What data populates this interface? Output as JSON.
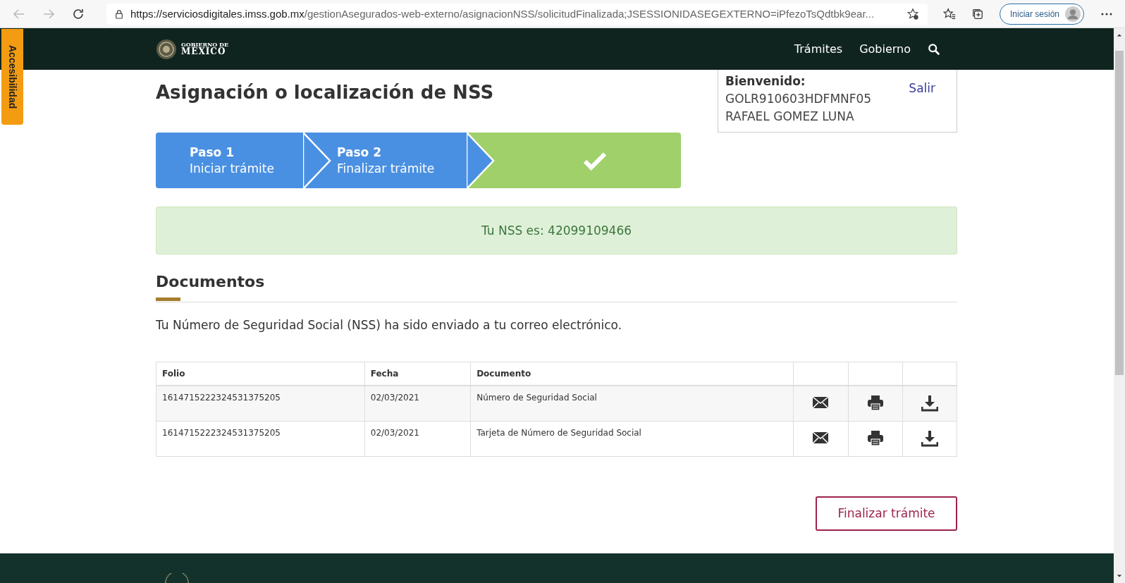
{
  "browser": {
    "url_host": "https://serviciosdigitales.imss.gob.mx",
    "url_path": "/gestionAsegurados-web-externo/asignacionNSS/solicitudFinalizada;JSESSIONIDASEGEXTERNO=iPfezoTsQdtbk9ear...",
    "sign_in": "Iniciar sesión"
  },
  "accessibility_tab": "Accesibilidad",
  "header": {
    "logo_top": "GOBIERNO DE",
    "logo_bottom": "MÉXICO",
    "nav": [
      "Trámites",
      "Gobierno"
    ]
  },
  "title": "Asignación o localización de NSS",
  "user": {
    "greeting": "Bienvenido:",
    "curp": "GOLR910603HDFMNF05",
    "name": "RAFAEL GOMEZ LUNA",
    "logout": "Salir"
  },
  "steps": [
    {
      "kind": "labeled",
      "label": "Paso 1",
      "caption": "Iniciar trámite"
    },
    {
      "kind": "labeled",
      "label": "Paso 2",
      "caption": "Finalizar trámite"
    },
    {
      "kind": "check"
    }
  ],
  "alert": "Tu NSS es: 42099109466",
  "section_title": "Documentos",
  "message": "Tu Número de Seguridad Social (NSS) ha sido enviado a tu correo electrónico.",
  "table": {
    "columns": [
      "Folio",
      "Fecha",
      "Documento"
    ],
    "rows": [
      {
        "folio": "1614715222324531375205",
        "fecha": "02/03/2021",
        "documento": "Número de Seguridad Social"
      },
      {
        "folio": "1614715222324531375205",
        "fecha": "02/03/2021",
        "documento": "Tarjeta de Número de Seguridad Social"
      }
    ]
  },
  "finish_button": "Finalizar trámite"
}
